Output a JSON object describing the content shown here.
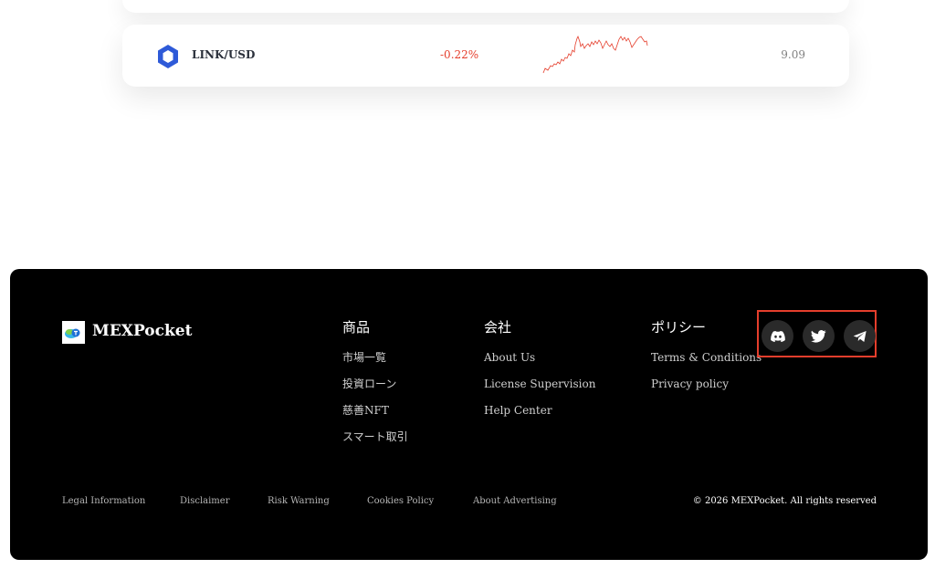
{
  "market": {
    "row": {
      "pair": "LINK/USD",
      "change": "-0.22%",
      "price": "9.09",
      "change_color": "#e53e2c",
      "icon": "chainlink-icon"
    }
  },
  "footer": {
    "brand": "MEXPocket",
    "columns": [
      {
        "title": "商品",
        "items": [
          "市場一覧",
          "投資ローン",
          "慈善NFT",
          "スマート取引"
        ]
      },
      {
        "title": "会社",
        "items": [
          "About Us",
          "License Supervision",
          "Help Center"
        ]
      },
      {
        "title": "ポリシー",
        "items": [
          "Terms & Conditions",
          "Privacy policy"
        ]
      }
    ],
    "social": [
      "discord-icon",
      "twitter-icon",
      "telegram-icon"
    ],
    "bottom_links": [
      "Legal Information",
      "Disclaimer",
      "Risk Warning",
      "Cookies Policy",
      "About Advertising"
    ],
    "copyright": "© 2026 MEXPocket. All rights reserved",
    "highlight_color": "#e53e2c"
  }
}
